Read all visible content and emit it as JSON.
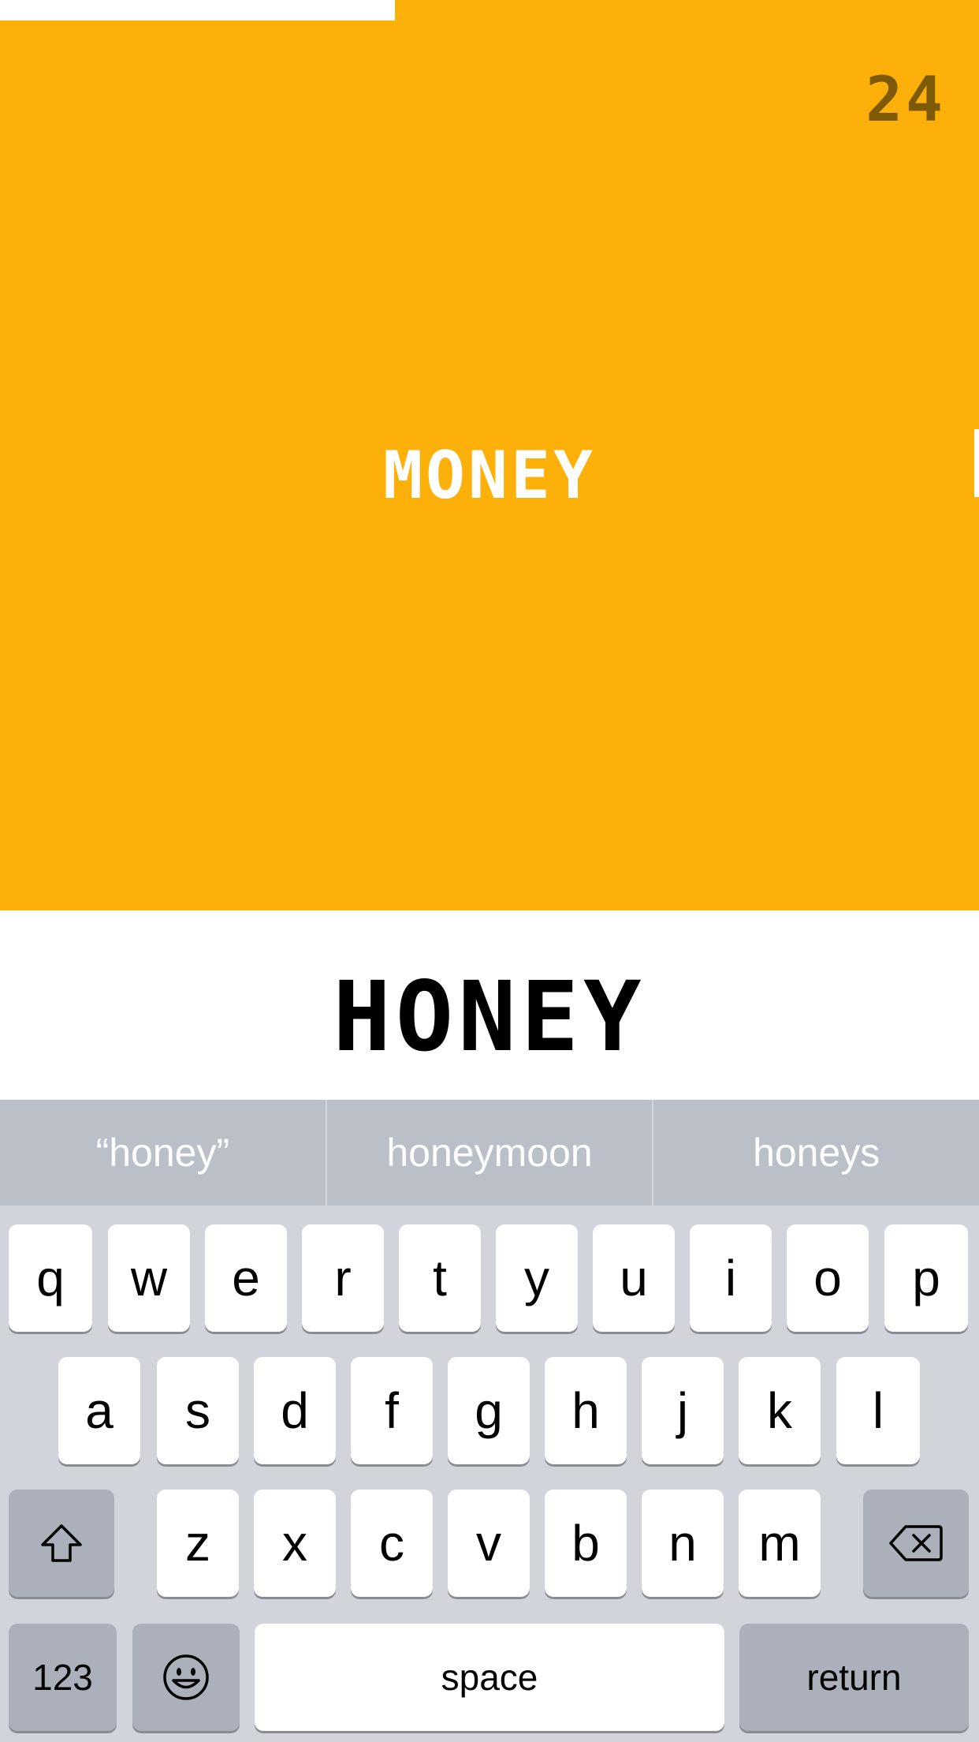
{
  "game": {
    "score": "24",
    "target_word": "MONEY",
    "typed_word": "HONEY"
  },
  "suggestions": [
    "“honey”",
    "honeymoon",
    "honeys"
  ],
  "keyboard": {
    "row1": [
      "q",
      "w",
      "e",
      "r",
      "t",
      "y",
      "u",
      "i",
      "o",
      "p"
    ],
    "row2": [
      "a",
      "s",
      "d",
      "f",
      "g",
      "h",
      "j",
      "k",
      "l"
    ],
    "row3": [
      "z",
      "x",
      "c",
      "v",
      "b",
      "n",
      "m"
    ],
    "numbers_label": "123",
    "space_label": "space",
    "return_label": "return",
    "shift_icon": "shift-icon",
    "delete_icon": "delete-icon",
    "emoji_icon": "emoji-icon"
  },
  "colors": {
    "game_background": "#FDB00A",
    "score_color": "#7E5A07",
    "suggestion_bar": "#BBC0C8",
    "keyboard_background": "#D1D4DB",
    "special_key": "#ACB0BB"
  }
}
